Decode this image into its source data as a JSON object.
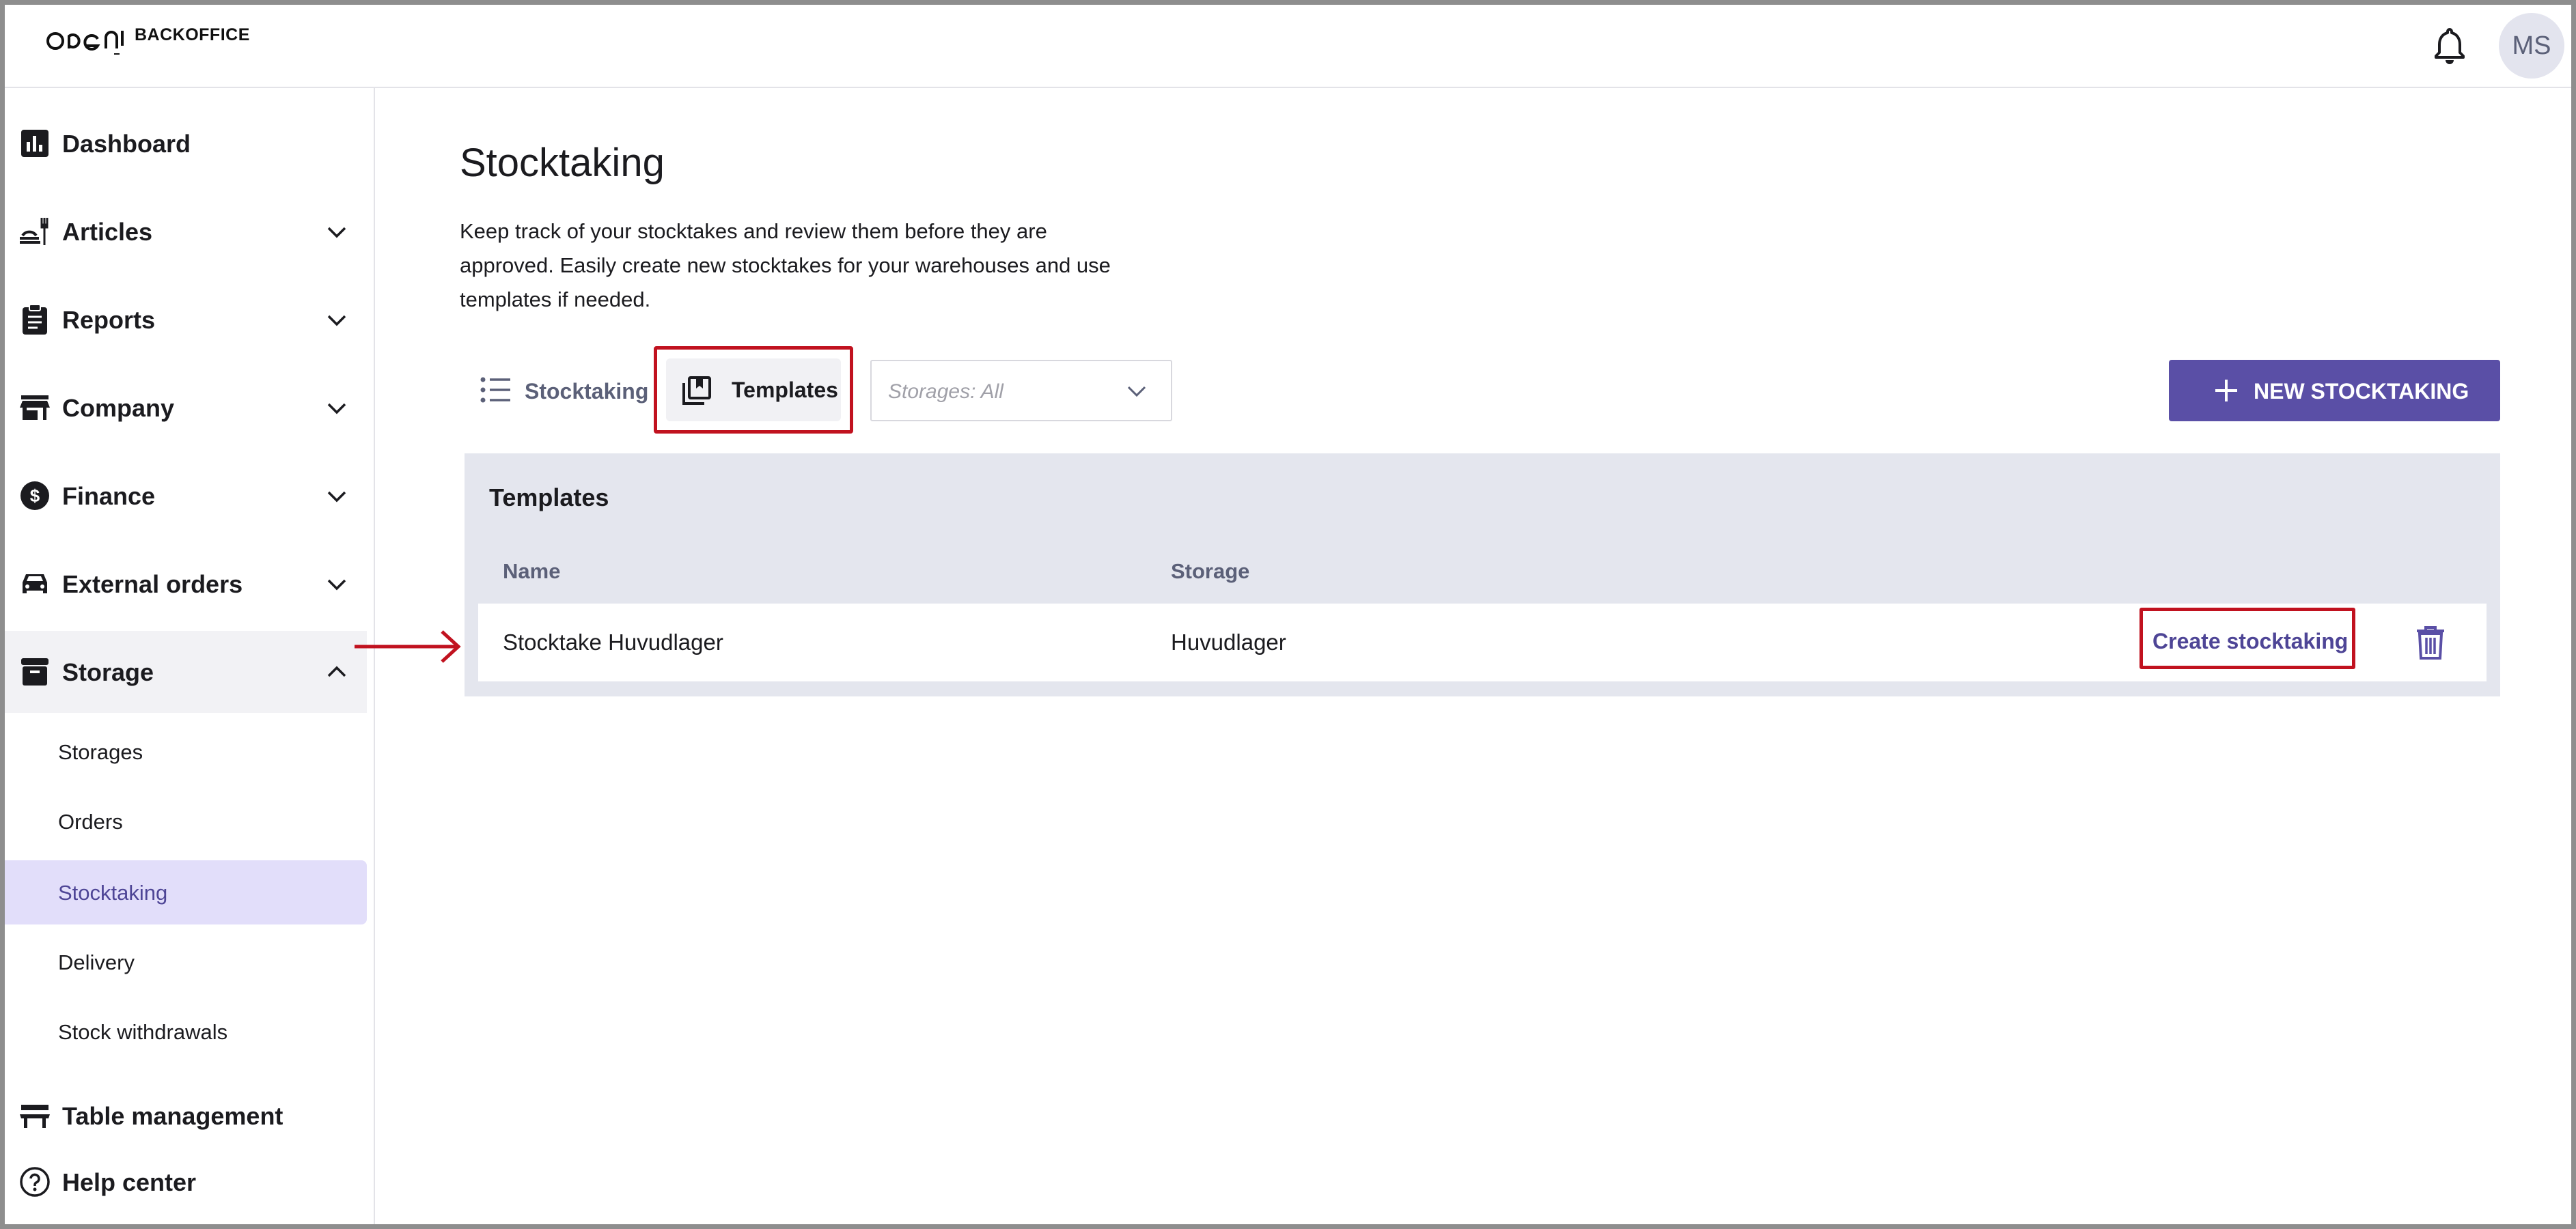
{
  "header": {
    "logo_text": "BACKOFFICE",
    "avatar_initials": "MS"
  },
  "sidebar": {
    "items": [
      {
        "label": "Dashboard",
        "icon": "bar-chart-icon"
      },
      {
        "label": "Articles",
        "icon": "food-service-icon",
        "expandable": true
      },
      {
        "label": "Reports",
        "icon": "clipboard-icon",
        "expandable": true
      },
      {
        "label": "Company",
        "icon": "storefront-icon",
        "expandable": true
      },
      {
        "label": "Finance",
        "icon": "dollar-coin-icon",
        "expandable": true
      },
      {
        "label": "External orders",
        "icon": "car-icon",
        "expandable": true
      },
      {
        "label": "Storage",
        "icon": "archive-box-icon",
        "expandable": true,
        "expanded": true
      },
      {
        "label": "Table management",
        "icon": "table-icon"
      },
      {
        "label": "Help center",
        "icon": "help-circle-icon"
      }
    ],
    "storage_subitems": [
      "Storages",
      "Orders",
      "Stocktaking",
      "Delivery",
      "Stock withdrawals"
    ],
    "active_subitem": "Stocktaking"
  },
  "main": {
    "title": "Stocktaking",
    "description": "Keep track of your stocktakes and review them before they are approved. Easily create new stocktakes for your warehouses and use templates if needed.",
    "tabs": [
      {
        "label": "Stocktaking",
        "icon": "list-icon"
      },
      {
        "label": "Templates",
        "icon": "templates-icon",
        "selected": true
      }
    ],
    "storage_filter": "Storages: All",
    "new_button": "NEW STOCKTAKING",
    "table": {
      "title": "Templates",
      "columns": [
        "Name",
        "Storage"
      ],
      "rows": [
        {
          "name": "Stocktake Huvudlager",
          "storage": "Huvudlager",
          "action": "Create stocktaking"
        }
      ]
    }
  },
  "colors": {
    "accent": "#5a4fa6",
    "active_bg": "#e2defa",
    "highlight": "#c1121f",
    "panel_bg": "#e4e6ee"
  }
}
